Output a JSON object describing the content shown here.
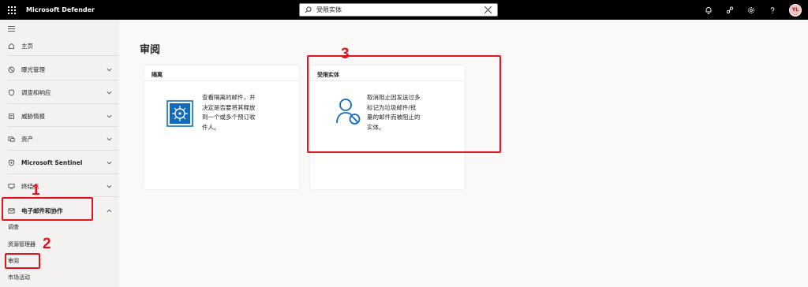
{
  "header": {
    "app_title": "Microsoft Defender",
    "search_value": "受限实体",
    "avatar_initials": "YL",
    "icons": [
      "bell-icon",
      "share-icon",
      "gear-icon",
      "help-icon"
    ]
  },
  "sidebar": {
    "items": [
      {
        "label": "主页",
        "icon": "home-icon",
        "chevron": false
      },
      {
        "label": "曝光管理",
        "icon": "exposure-icon",
        "chevron": true
      },
      {
        "label": "调查和响应",
        "icon": "shield-icon",
        "chevron": true
      },
      {
        "label": "威胁情报",
        "icon": "intel-icon",
        "chevron": true
      },
      {
        "label": "资产",
        "icon": "assets-icon",
        "chevron": true
      },
      {
        "label": "Microsoft Sentinel",
        "icon": "sentinel-icon",
        "chevron": true
      },
      {
        "label": "终结点",
        "icon": "endpoint-icon",
        "chevron": true
      },
      {
        "label": "电子邮件和协作",
        "icon": "mail-icon",
        "chevron": true,
        "expanded": true
      }
    ],
    "sub_items": [
      "调查",
      "资源管理器",
      "审阅",
      "市场活动"
    ]
  },
  "main": {
    "page_title": "审阅",
    "cards": [
      {
        "title": "隔离",
        "icon": "quarantine-icon",
        "desc_lines": [
          "查看隔离的邮件，并",
          "决定是否要将其释放",
          "到一个或多个预订收",
          "件人。"
        ]
      },
      {
        "title": "受限实体",
        "icon": "restricted-user-icon",
        "desc_lines": [
          "取消阻止因发送过多",
          "标记为垃圾邮件/批",
          "量的邮件而被阻止的",
          "实体。"
        ]
      }
    ]
  },
  "annotations": {
    "numbers": [
      "1",
      "2",
      "3"
    ],
    "color": "#e0141e"
  },
  "colors": {
    "topbar": "#000000",
    "accent": "#0f6cbd",
    "sidebar_bg": "#f3f2f1",
    "main_bg": "#faf9f8"
  }
}
